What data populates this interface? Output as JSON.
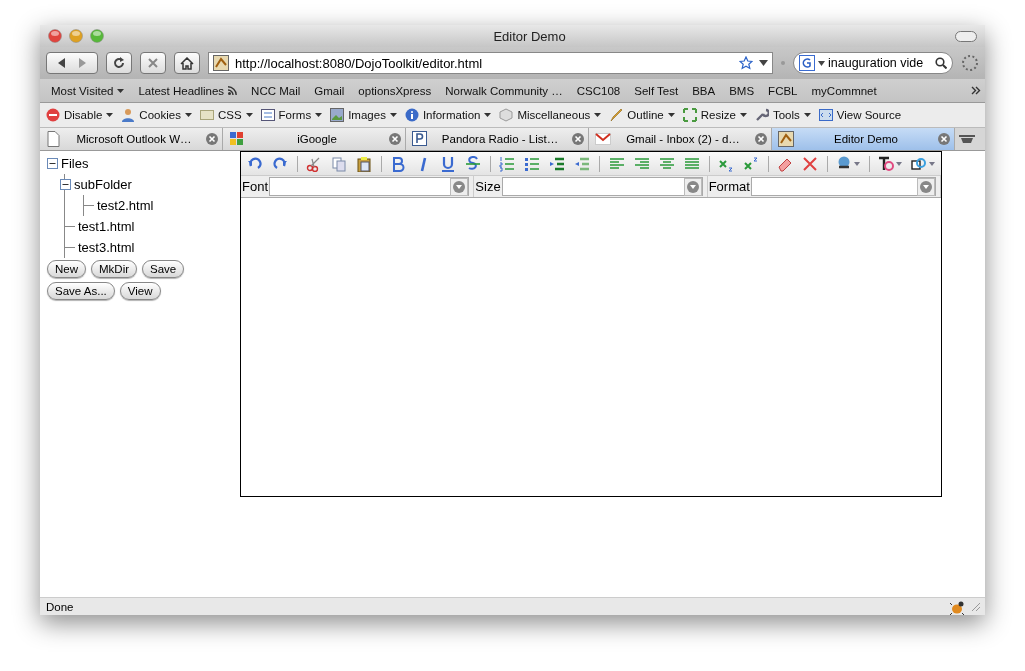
{
  "window": {
    "title": "Editor Demo"
  },
  "navigation": {
    "url": "http://localhost:8080/DojoToolkit/editor.html",
    "search": "inauguration vide"
  },
  "bookmarks": [
    {
      "label": "Most Visited",
      "menu": true,
      "feed": false
    },
    {
      "label": "Latest Headlines",
      "menu": false,
      "feed": true
    },
    {
      "label": "NCC Mail",
      "menu": false,
      "feed": false
    },
    {
      "label": "Gmail",
      "menu": false,
      "feed": false
    },
    {
      "label": "optionsXpress",
      "menu": false,
      "feed": false
    },
    {
      "label": "Norwalk Community …",
      "menu": false,
      "feed": false
    },
    {
      "label": "CSC108",
      "menu": false,
      "feed": false
    },
    {
      "label": "Self Test",
      "menu": false,
      "feed": false
    },
    {
      "label": "BBA",
      "menu": false,
      "feed": false
    },
    {
      "label": "BMS",
      "menu": false,
      "feed": false
    },
    {
      "label": "FCBL",
      "menu": false,
      "feed": false
    },
    {
      "label": "myCommnet",
      "menu": false,
      "feed": false
    }
  ],
  "devtools": [
    {
      "label": "Disable",
      "kind": "disable",
      "menu": true
    },
    {
      "label": "Cookies",
      "kind": "cookies",
      "menu": true
    },
    {
      "label": "CSS",
      "kind": "css",
      "menu": true
    },
    {
      "label": "Forms",
      "kind": "forms",
      "menu": true
    },
    {
      "label": "Images",
      "kind": "images",
      "menu": true
    },
    {
      "label": "Information",
      "kind": "information",
      "menu": true
    },
    {
      "label": "Miscellaneous",
      "kind": "misc",
      "menu": true
    },
    {
      "label": "Outline",
      "kind": "outline",
      "menu": true
    },
    {
      "label": "Resize",
      "kind": "resize",
      "menu": true
    },
    {
      "label": "Tools",
      "kind": "tools",
      "menu": true
    },
    {
      "label": "View Source",
      "kind": "source",
      "menu": false
    }
  ],
  "tabs": [
    {
      "label": "Microsoft Outlook W…",
      "kind": "page",
      "selected": false
    },
    {
      "label": "iGoogle",
      "kind": "google",
      "selected": false
    },
    {
      "label": "Pandora Radio - List…",
      "kind": "pandora",
      "selected": false
    },
    {
      "label": "Gmail - Inbox (2) - d…",
      "kind": "mail",
      "selected": false
    },
    {
      "label": "Editor Demo",
      "kind": "dojo",
      "selected": true
    }
  ],
  "file_tree": {
    "label": "Files",
    "expanded": true,
    "children": [
      {
        "label": "subFolder",
        "expanded": true,
        "children": [
          {
            "label": "test2.html"
          }
        ]
      },
      {
        "label": "test1.html"
      },
      {
        "label": "test3.html"
      }
    ]
  },
  "buttons": [
    "New",
    "MkDir",
    "Save",
    "Save As...",
    "View"
  ],
  "editor": {
    "fields": [
      {
        "label": "Font"
      },
      {
        "label": "Size"
      },
      {
        "label": "Format"
      }
    ]
  },
  "status_bar": {
    "text": "Done"
  }
}
